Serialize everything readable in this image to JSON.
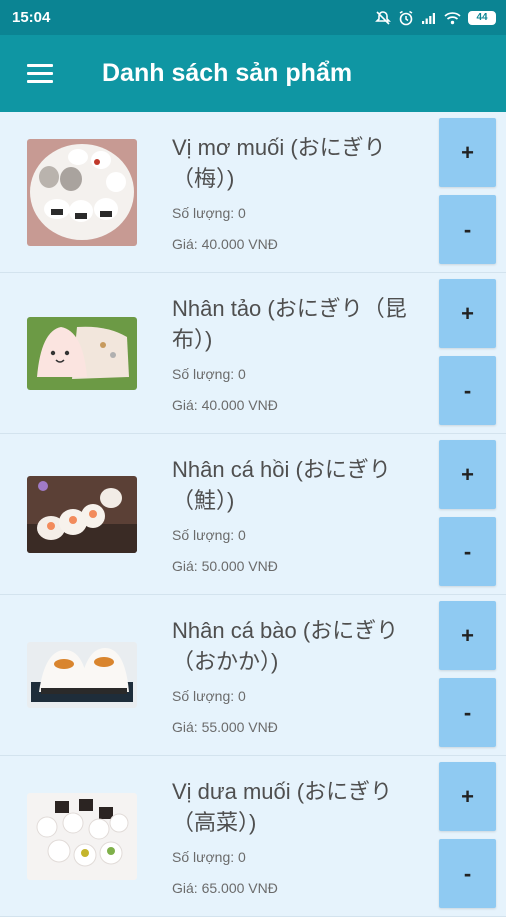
{
  "status_bar": {
    "time": "15:04",
    "battery": "44"
  },
  "app_bar": {
    "title": "Danh sách sản phẩm"
  },
  "buttons": {
    "plus": "+",
    "minus": "-"
  },
  "products": [
    {
      "name": "Vị mơ muối (おにぎり（梅）)",
      "quantity": "Số lượng: 0",
      "price": "Giá: 40.000 VNĐ"
    },
    {
      "name": "Nhân tảo (おにぎり（昆布）)",
      "quantity": "Số lượng: 0",
      "price": "Giá: 40.000 VNĐ"
    },
    {
      "name": "Nhân cá hồi (おにぎり（鮭）)",
      "quantity": "Số lượng: 0",
      "price": "Giá: 50.000 VNĐ"
    },
    {
      "name": "Nhân cá bào (おにぎり（おかか）)",
      "quantity": "Số lượng: 0",
      "price": "Giá: 55.000 VNĐ"
    },
    {
      "name": "Vị dưa muối (おにぎり（高菜）)",
      "quantity": "Số lượng: 0",
      "price": "Giá: 65.000 VNĐ"
    }
  ]
}
